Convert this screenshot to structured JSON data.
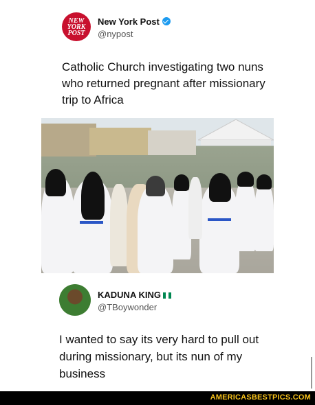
{
  "tweet1": {
    "avatar_text": [
      "NEW",
      "YORK",
      "POST"
    ],
    "name": "New York Post",
    "handle": "@nypost",
    "headline": "Catholic Church investigating two nuns who returned pregnant after missionary trip to Africa"
  },
  "tweet2": {
    "name": "KADUNA KING",
    "handle": "@TBoywonder",
    "text": "I wanted to say its very hard to pull out during missionary, but its nun of my business"
  },
  "footer": {
    "watermark": "AMERICASBESTPICS.COM"
  },
  "colors": {
    "nyp_red": "#c8102e",
    "verified_blue": "#1d9bf0",
    "watermark_yellow": "#f7c21a"
  },
  "icons": [
    "verified-badge-icon",
    "nigeria-flag-icon"
  ]
}
